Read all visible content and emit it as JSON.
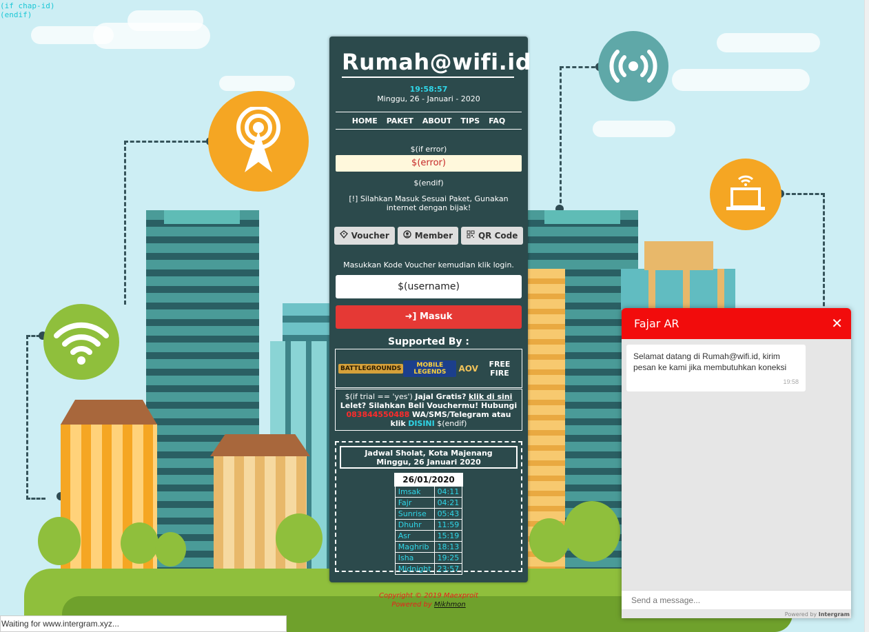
{
  "debug": {
    "line1": "(if chap-id)",
    "line2": "(endif)"
  },
  "brand": "Rumah@wifi.id",
  "clock": "19:58:57",
  "date": "Minggu, 26 - Januari - 2020",
  "nav": [
    "HOME",
    "PAKET",
    "ABOUT",
    "TIPS",
    "FAQ"
  ],
  "template": {
    "if_error": "$(if error)",
    "error": "$(error)",
    "endif": "$(endif)"
  },
  "notice": "[!] Silahkan Masuk Sesuai Paket, Gunakan internet dengan bijak!",
  "tabs": [
    {
      "label": "Voucher",
      "icon": "ticket-icon"
    },
    {
      "label": "Member",
      "icon": "user-circle-icon"
    },
    {
      "label": "QR Code",
      "icon": "qrcode-icon"
    }
  ],
  "voucher_hint": "Masukkan Kode Voucher kemudian klik login.",
  "username_value": "$(username)",
  "masuk_label": "Masuk",
  "supported_title": "Supported By :",
  "logos": [
    "BATTLEGROUNDS",
    "MOBILE LEGENDS",
    "AOV",
    "FREE FIRE"
  ],
  "trial": {
    "prefix": "$(if trial == 'yes')",
    "jajal": "Jajal Gratis?",
    "link": "klik di sini",
    "lelet": "Lelet? Silahkan Beli Vouchermu! Hubungi",
    "phone": "083844550488",
    "wa": "WA/SMS/Telegram atau klik",
    "disini": "DISINI",
    "endif": "$(endif)"
  },
  "jadwal": {
    "title": "Jadwal Sholat, Kota Majenang",
    "date": "Minggu, 26 Januari 2020",
    "table_date": "26/01/2020",
    "times": [
      {
        "name": "Imsak",
        "time": "04:11"
      },
      {
        "name": "Fajr",
        "time": "04:21"
      },
      {
        "name": "Sunrise",
        "time": "05:43"
      },
      {
        "name": "Dhuhr",
        "time": "11:59"
      },
      {
        "name": "Asr",
        "time": "15:19"
      },
      {
        "name": "Maghrib",
        "time": "18:13"
      },
      {
        "name": "Isha",
        "time": "19:25"
      },
      {
        "name": "Midnight",
        "time": "23:57"
      }
    ]
  },
  "footer": {
    "copyright": "Copyright © 2019 Maexproit",
    "powered_prefix": "Powered by",
    "powered_link": "Mikhmon"
  },
  "chat": {
    "title": "Fajar AR",
    "message": "Selamat datang di Rumah@wifi.id, kirim pesan ke kami jika membutuhkan koneksi",
    "time": "19:58",
    "placeholder": "Send a message...",
    "powered_prefix": "Powered by",
    "powered_brand": "Intergram"
  },
  "status": "Waiting for www.intergram.xyz...",
  "colors": {
    "card": "#2c4a4c",
    "accent_cyan": "#2fd6e8",
    "masuk": "#e53935",
    "chat_header": "#f20c0c",
    "sky": "#cdeef4"
  }
}
